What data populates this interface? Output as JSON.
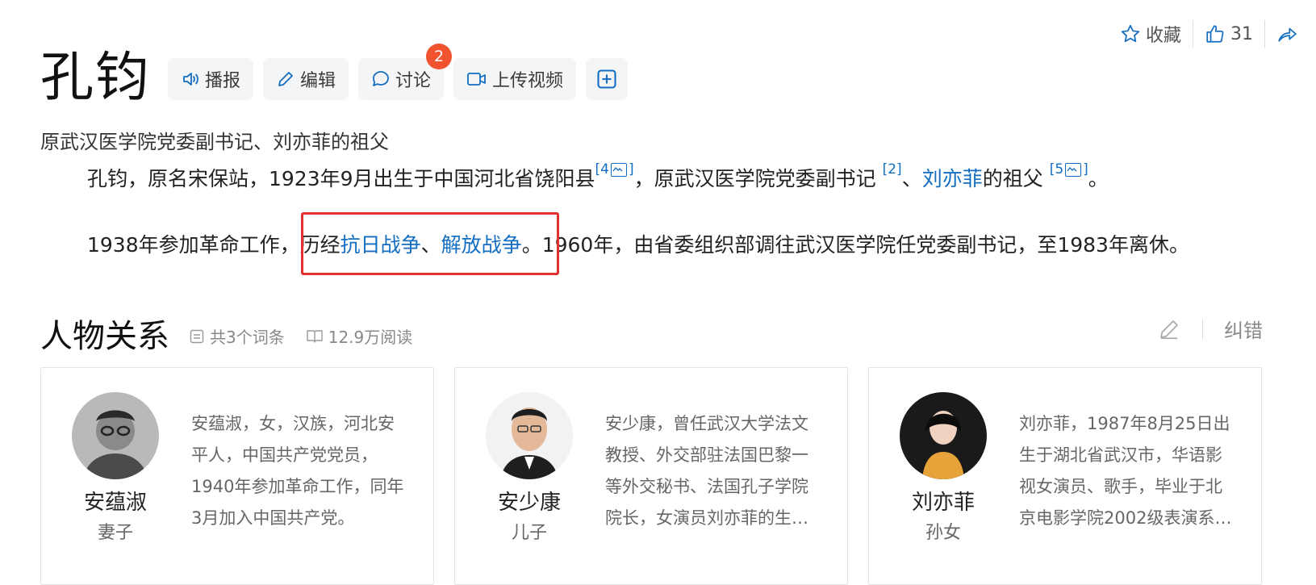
{
  "top_actions": {
    "favorite_label": "收藏",
    "like_count": "31"
  },
  "title": "孔钧",
  "toolbar": {
    "broadcast_label": "播报",
    "edit_label": "编辑",
    "discuss_label": "讨论",
    "discuss_badge": "2",
    "upload_video_label": "上传视频"
  },
  "subtitle": "原武汉医学院党委副书记、刘亦菲的祖父",
  "paragraph1": {
    "text1": "孔钧，原名宋保站，1923年9月出生于中国河北省饶阳县",
    "cite1": "[4",
    "cite1_close": "]",
    "text2": "，原武汉医学院党委副书记",
    "cite2": "[2]",
    "text3": "、",
    "link1": "刘亦菲",
    "text4": "的祖父",
    "cite3": "[5",
    "cite3_close": "]",
    "text5": "。"
  },
  "paragraph2": {
    "text1": "1938年参加革命工作，",
    "text2": "历经",
    "link1": "抗日战争",
    "text3": "、",
    "link2": "解放战争",
    "text4": "。",
    "text5": "1960年，由省委组织部调往武汉医学院任党委副书记，至1983年离休。"
  },
  "section": {
    "title": "人物关系",
    "entries": "共3个词条",
    "reads": "12.9万阅读",
    "report_label": "纠错"
  },
  "relations": [
    {
      "name": "安蕴淑",
      "relation": "妻子",
      "desc": "安蕴淑，女，汉族，河北安平人，中国共产党党员，1940年参加革命工作，同年3月加入中国共产党。"
    },
    {
      "name": "安少康",
      "relation": "儿子",
      "desc": "安少康，曾任武汉大学法文教授、外交部驻法国巴黎一等外交秘书、法国孔子学院院长，女演员刘亦菲的生父。"
    },
    {
      "name": "刘亦菲",
      "relation": "孙女",
      "desc": "刘亦菲，1987年8月25日出生于湖北省武汉市，华语影视女演员、歌手，毕业于北京电影学院2002级表演系本科。"
    }
  ],
  "colors": {
    "link": "#136ec2",
    "highlight_box": "#e0302f",
    "badge": "#f0532d"
  }
}
